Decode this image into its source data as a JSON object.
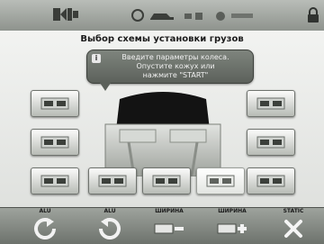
{
  "header": {
    "logo_icon": "brand-logo-icon",
    "status_icons": [
      "wheel-icon",
      "car-icon",
      "settings-icon"
    ],
    "right_icon": "lock-icon"
  },
  "screen": {
    "title": "Выбор схемы установки грузов"
  },
  "tooltip": {
    "icon": "info-icon",
    "lines": [
      "Введите параметры колеса.",
      "Опустите кожух или",
      "нажмите \"START\""
    ]
  },
  "planes": {
    "left": [
      "plane-option-1",
      "plane-option-2",
      "plane-option-3"
    ],
    "right": [
      "plane-option-1",
      "plane-option-2",
      "plane-option-3"
    ],
    "center": [
      "plane-option-a",
      "plane-option-b",
      "plane-option-c",
      "plane-option-d"
    ]
  },
  "footer": {
    "labels": [
      "ALU",
      "ALU",
      "ШИРИНА",
      "ШИРИНА",
      "STATIC"
    ],
    "buttons": [
      "rotate-left-icon",
      "rotate-right-icon",
      "width-minus-icon",
      "width-plus-icon",
      "close-icon"
    ]
  },
  "colors": {
    "bar": "#8e938d",
    "background": "#e7e9e6",
    "tooltip": "#6a706a",
    "accent": "#ffffff"
  }
}
